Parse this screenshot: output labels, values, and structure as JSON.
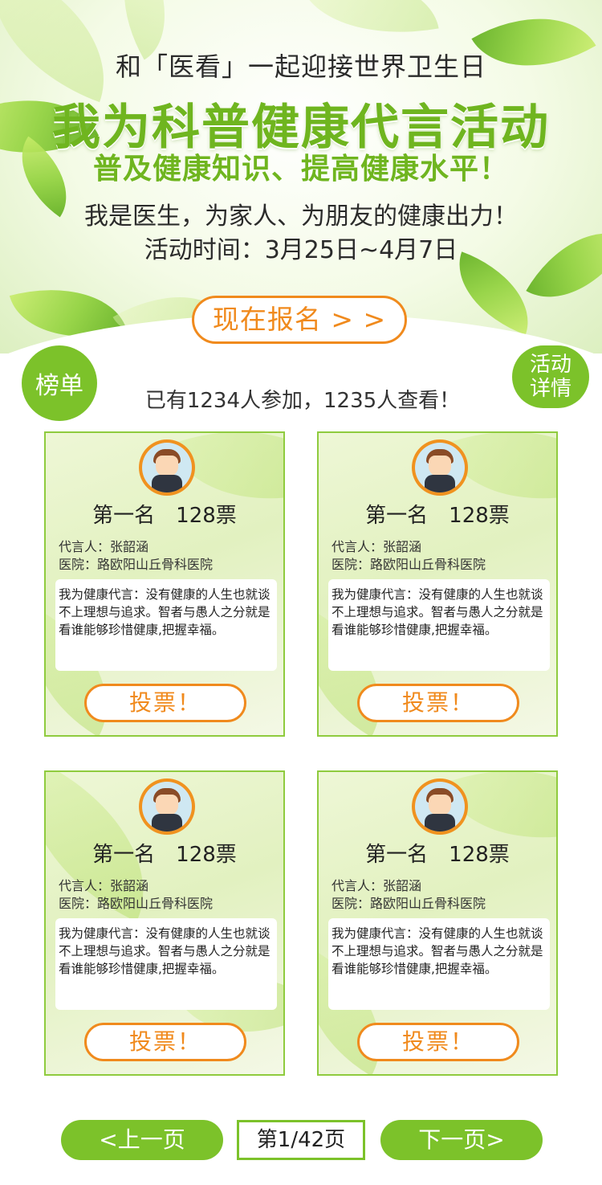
{
  "header": {
    "line1": "和「医看」一起迎接世界卫生日",
    "title": "我为科普健康代言活动",
    "subtitle": "普及健康知识、提高健康水平！",
    "line4": "我是医生，为家人、为朋友的健康出力！",
    "line5": "活动时间：3月25日~4月7日",
    "signup_button": "现在报名 > >"
  },
  "rank_badge": "榜单",
  "detail_badge": {
    "line1": "活动",
    "line2": "详情"
  },
  "stats": "已有1234人参加，1235人查看！",
  "cards": [
    {
      "rank_votes": "第一名　128票",
      "person": "代言人：张韶涵",
      "hospital": "医院：路欧阳山丘骨科医院",
      "quote": "我为健康代言：没有健康的人生也就谈不上理想与追求。智者与愚人之分就是看谁能够珍惜健康,把握幸福。",
      "vote_button": "投票！"
    },
    {
      "rank_votes": "第一名　128票",
      "person": "代言人：张韶涵",
      "hospital": "医院：路欧阳山丘骨科医院",
      "quote": "我为健康代言：没有健康的人生也就谈不上理想与追求。智者与愚人之分就是看谁能够珍惜健康,把握幸福。",
      "vote_button": "投票！"
    },
    {
      "rank_votes": "第一名　128票",
      "person": "代言人：张韶涵",
      "hospital": "医院：路欧阳山丘骨科医院",
      "quote": "我为健康代言：没有健康的人生也就谈不上理想与追求。智者与愚人之分就是看谁能够珍惜健康,把握幸福。",
      "vote_button": "投票！"
    },
    {
      "rank_votes": "第一名　128票",
      "person": "代言人：张韶涵",
      "hospital": "医院：路欧阳山丘骨科医院",
      "quote": "我为健康代言：没有健康的人生也就谈不上理想与追求。智者与愚人之分就是看谁能够珍惜健康,把握幸福。",
      "vote_button": "投票！"
    }
  ],
  "pagination": {
    "prev": "<上一页",
    "info": "第1/42页",
    "next": "下一页>"
  },
  "colors": {
    "green": "#7cc22a",
    "title_green": "#6fb51f",
    "orange": "#f08a1d"
  }
}
